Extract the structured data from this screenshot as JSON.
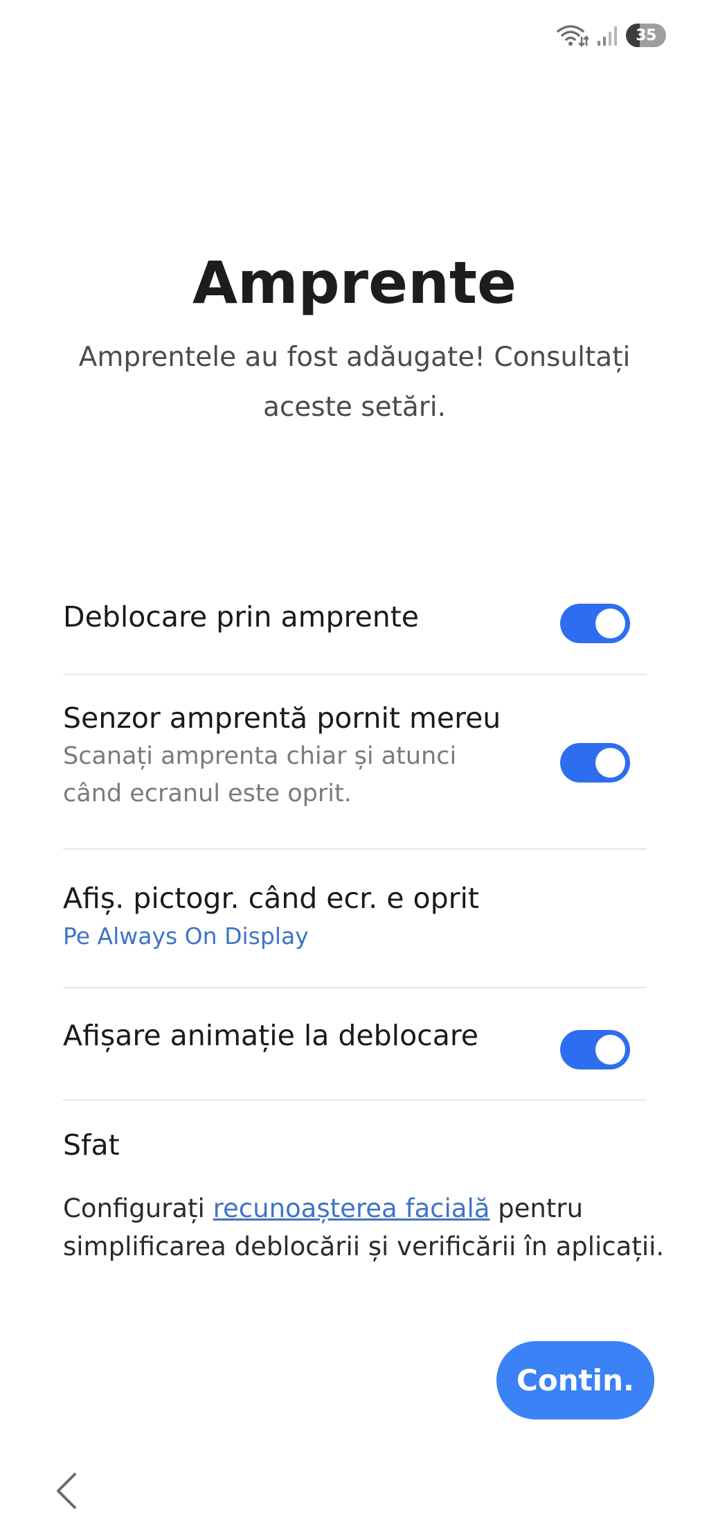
{
  "status_bar": {
    "wifi_icon": "wifi-data-icon",
    "signal_icon": "cell-signal-icon",
    "battery_level": "35",
    "battery_fraction": 0.35
  },
  "header": {
    "title": "Amprente",
    "subtitle": "Amprentele au fost adăugate! Consultați aceste setări."
  },
  "settings": [
    {
      "label": "Deblocare prin amprente",
      "description": "",
      "toggle": true
    },
    {
      "label": "Senzor amprentă pornit mereu",
      "description": "Scanați amprenta chiar și atunci când ecranul este oprit.",
      "toggle": true
    },
    {
      "label": "Afiș. pictogr. când ecr. e oprit",
      "description": "Pe Always On Display",
      "toggle": null
    },
    {
      "label": "Afișare animație la deblocare",
      "description": "",
      "toggle": true
    }
  ],
  "tip": {
    "title": "Sfat",
    "text_before": "Configurați ",
    "link": "recunoașterea facială",
    "text_after": " pentru simplificarea deblocării și verificării în aplicații."
  },
  "continue_label": "Contin.",
  "back_icon": "chevron-left-icon",
  "colors": {
    "accent": "#3b82f6",
    "toggle_on": "#2d6ef0",
    "link": "#3f73c7"
  }
}
